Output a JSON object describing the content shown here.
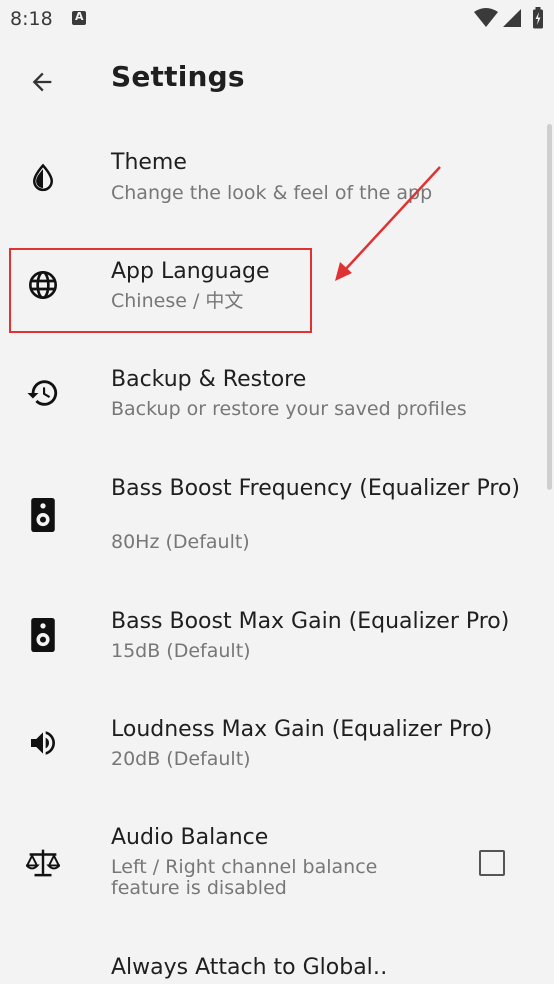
{
  "status_bar": {
    "time": "8:18"
  },
  "app_bar": {
    "title": "Settings"
  },
  "settings": [
    {
      "title": "Theme",
      "subtitle": "Change the look & feel of the app",
      "icon": "theme-icon"
    },
    {
      "title": "App Language",
      "subtitle": "Chinese / 中文",
      "icon": "globe-icon"
    },
    {
      "title": "Backup & Restore",
      "subtitle": "Backup or restore your saved profiles",
      "icon": "restore-icon"
    },
    {
      "title": "Bass Boost Frequency (Equalizer Pro)",
      "subtitle": "80Hz (Default)",
      "icon": "speaker-icon"
    },
    {
      "title": "Bass Boost Max Gain (Equalizer Pro)",
      "subtitle": "15dB (Default)",
      "icon": "speaker-icon"
    },
    {
      "title": "Loudness Max Gain (Equalizer Pro)",
      "subtitle": "20dB (Default)",
      "icon": "volume-icon"
    },
    {
      "title": "Audio Balance",
      "subtitle": "Left / Right channel balance feature is disabled",
      "icon": "balance-icon",
      "checked": false
    },
    {
      "title": "Always Attach to Global‥",
      "subtitle": "",
      "icon": ""
    }
  ],
  "colors": {
    "background": "#f3f3f3",
    "annotation": "#e03232",
    "text_primary": "#1f1f1f",
    "text_secondary": "#777777"
  }
}
